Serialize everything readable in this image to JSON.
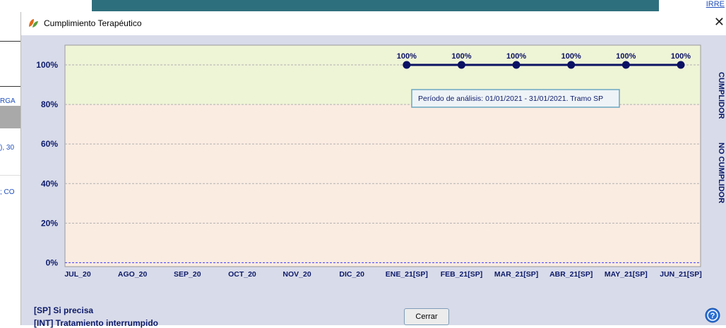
{
  "background": {
    "corner_link": "IRRE",
    "frag_1": "RGA",
    "frag_2": "), 30",
    "frag_3": "; CO"
  },
  "dialog": {
    "title": "Cumplimiento Terapéutico",
    "close_label": "Cerrar",
    "legend_sp": "[SP] Si precisa",
    "legend_int": "[INT] Tratamiento interrumpido",
    "tooltip": "Período de análisis: 01/01/2021 - 31/01/2021. Tramo SP",
    "zone_top": "CUMPLIDOR",
    "zone_bottom": "NO CUMPLIDOR"
  },
  "colors": {
    "compliant_zone": "#eef4d6",
    "noncompliant_zone": "#fbece2",
    "series": "#0a1063",
    "text": "#0c1a6a",
    "zero_line": "#3b3bff"
  },
  "chart_data": {
    "type": "line",
    "categories": [
      "JUL_20",
      "AGO_20",
      "SEP_20",
      "OCT_20",
      "NOV_20",
      "DIC_20",
      "ENE_21[SP]",
      "FEB_21[SP]",
      "MAR_21[SP]",
      "ABR_21[SP]",
      "MAY_21[SP]",
      "JUN_21[SP]"
    ],
    "series": [
      {
        "values": [
          null,
          null,
          null,
          null,
          null,
          null,
          100,
          100,
          100,
          100,
          100,
          100
        ],
        "labels": [
          "",
          "",
          "",
          "",
          "",
          "",
          "100%",
          "100%",
          "100%",
          "100%",
          "100%",
          "100%"
        ]
      }
    ],
    "yticks": [
      "0%",
      "20%",
      "40%",
      "60%",
      "80%",
      "100%"
    ],
    "yvalues": [
      0,
      20,
      40,
      60,
      80,
      100
    ],
    "ylim": [
      -2,
      110
    ],
    "threshold": 80,
    "grid": true
  }
}
